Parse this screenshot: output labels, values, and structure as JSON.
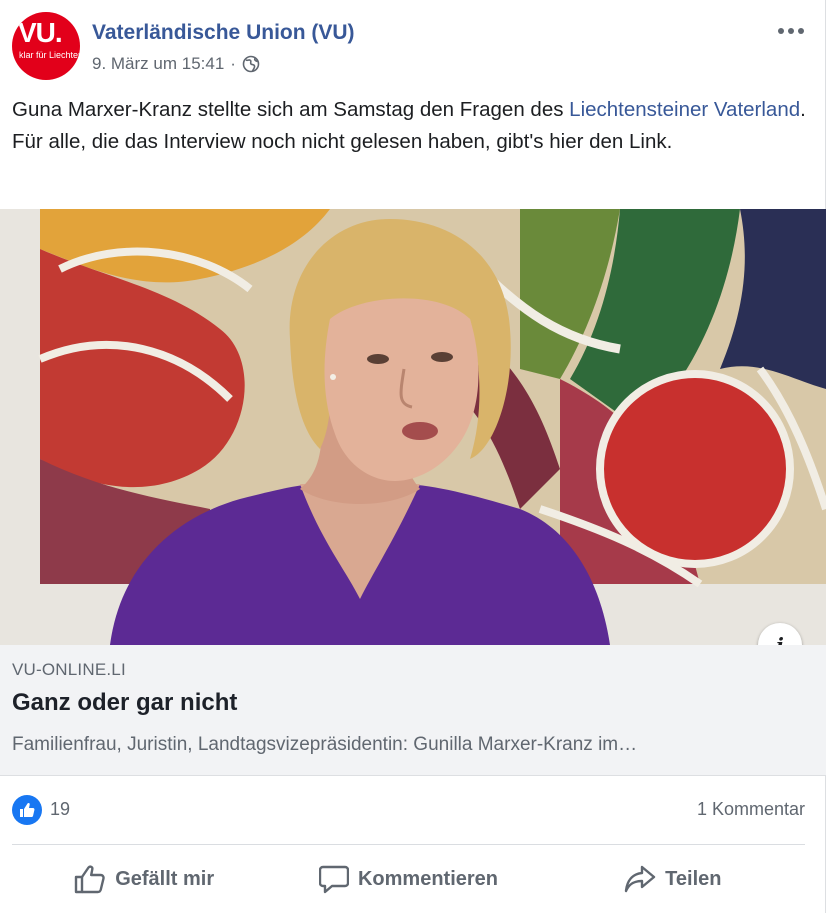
{
  "post": {
    "page_name": "Vaterländische Union (VU)",
    "avatar": {
      "logo": "VU.",
      "tagline": "klar für Liechtenstein",
      "color": "#e2001a"
    },
    "timestamp": "9. März um 15:41",
    "separator": "·",
    "privacy_icon": "globe-icon",
    "more_icon": "more-options-icon",
    "text_before": "Guna Marxer-Kranz stellte sich am Samstag den Fragen des ",
    "text_link": "Liechtensteiner Vaterland",
    "text_after": ". Für alle, die das Interview noch nicht gelesen haben, gibt's hier den Link."
  },
  "link_preview": {
    "domain": "VU-ONLINE.LI",
    "title": "Ganz oder gar nicht",
    "description": "Familienfrau, Juristin, Landtagsvizepräsidentin: Gunilla Marxer-Kranz im…",
    "info_label": "i"
  },
  "engagement": {
    "like_count": "19",
    "comment_count": "1 Kommentar"
  },
  "actions": {
    "like_label": "Gefällt mir",
    "comment_label": "Kommentieren",
    "share_label": "Teilen"
  },
  "colors": {
    "link_blue": "#385898",
    "like_blue": "#1877f2",
    "muted_text": "#606770"
  }
}
